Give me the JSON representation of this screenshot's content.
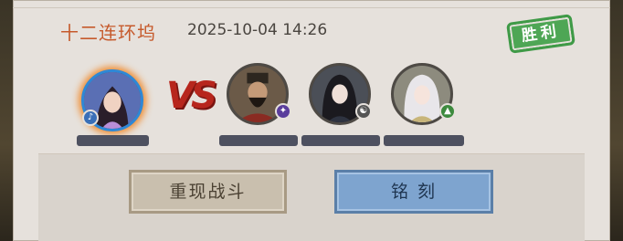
{
  "match": {
    "title": "十二连环坞",
    "datetime": "2025-10-04 14:26",
    "result": "胜利"
  },
  "vs_label": "VS",
  "players": {
    "self": {
      "avatar": "female-hero-avatar",
      "badge_icon": "music-icon"
    },
    "opponents": [
      {
        "avatar": "bearded-warrior-avatar",
        "badge_icon": "staff-icon"
      },
      {
        "avatar": "dark-haired-woman-avatar",
        "badge_icon": "yin-yang-icon"
      },
      {
        "avatar": "white-haired-girl-avatar",
        "badge_icon": "boot-icon"
      }
    ]
  },
  "buttons": {
    "replay": "重现战斗",
    "engrave": "铭 刻"
  },
  "colors": {
    "title": "#c65a2c",
    "result_stamp": "#4ea655",
    "vs": "#b7261d",
    "engrave_button": "#7ea4cf"
  }
}
